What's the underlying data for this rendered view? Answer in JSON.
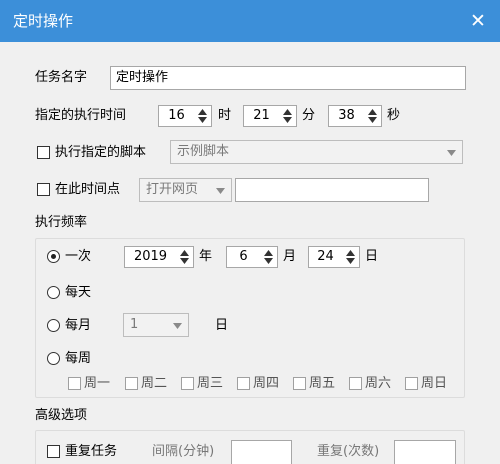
{
  "window": {
    "title": "定时操作",
    "close_glyph": "✕"
  },
  "task_name": {
    "label": "任务名字",
    "value": "定时操作"
  },
  "exec_time": {
    "label": "指定的执行时间",
    "hour": "16",
    "hour_unit": "时",
    "minute": "21",
    "minute_unit": "分",
    "second": "38",
    "second_unit": "秒"
  },
  "script": {
    "checkbox_label": "执行指定的脚本",
    "selected": "示例脚本"
  },
  "time_point": {
    "checkbox_label": "在此时间点",
    "action": "打开网页",
    "url_value": ""
  },
  "frequency": {
    "title": "执行频率",
    "once": {
      "label": "一次",
      "year": "2019",
      "year_unit": "年",
      "month": "6",
      "month_unit": "月",
      "day": "24",
      "day_unit": "日"
    },
    "daily": {
      "label": "每天"
    },
    "monthly": {
      "label": "每月",
      "day_value": "1",
      "day_unit": "日"
    },
    "weekly": {
      "label": "每周",
      "days": [
        "周一",
        "周二",
        "周三",
        "周四",
        "周五",
        "周六",
        "周日"
      ]
    }
  },
  "advanced": {
    "title": "高级选项",
    "repeat_label": "重复任务",
    "interval_label": "间隔(分钟)",
    "repeat_count_label": "重复(次数)",
    "interval_value": "",
    "repeat_count_value": ""
  },
  "colors": {
    "titlebar": "#3c8fd9",
    "background": "#f0f0f0"
  }
}
